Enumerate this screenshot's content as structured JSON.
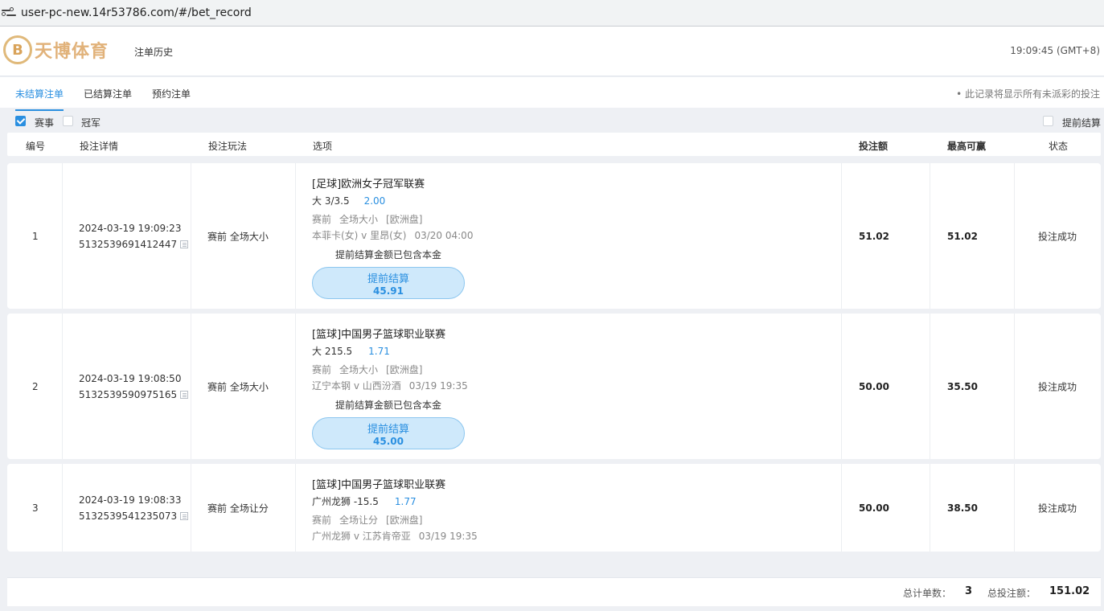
{
  "browser": {
    "url": "user-pc-new.14r53786.com/#/bet_record"
  },
  "header": {
    "logo_letter": "B",
    "brand": "天博体育",
    "page_title": "注单历史",
    "clock": "19:09:45 (GMT+8)"
  },
  "tabs": [
    {
      "label": "未结算注单",
      "active": true
    },
    {
      "label": "已结算注单",
      "active": false
    },
    {
      "label": "预约注单",
      "active": false
    }
  ],
  "notice": "• 此记录将显示所有未派彩的投注",
  "filters": {
    "event": {
      "label": "赛事",
      "checked": true
    },
    "champion": {
      "label": "冠军",
      "checked": false
    },
    "early_settle": {
      "label": "提前结算",
      "checked": false
    }
  },
  "columns": {
    "index": "编号",
    "detail": "投注详情",
    "play": "投注玩法",
    "option": "选项",
    "stake": "投注额",
    "max_win": "最高可赢",
    "status": "状态"
  },
  "rows": [
    {
      "index": "1",
      "datetime": "2024-03-19 19:09:23",
      "order_no": "5132539691412447",
      "play": "赛前 全场大小",
      "league": "[足球]欧洲女子冠军联赛",
      "pick": "大 3/3.5",
      "odds": "2.00",
      "meta": [
        "赛前",
        "全场大小",
        "[欧洲盘]"
      ],
      "match": "本菲卡(女) v 里昂(女)",
      "match_time": "03/20 04:00",
      "include_note": "提前结算金额已包含本金",
      "cashout_label": "提前结算",
      "cashout_amount": "45.91",
      "stake": "51.02",
      "max_win": "51.02",
      "status": "投注成功"
    },
    {
      "index": "2",
      "datetime": "2024-03-19 19:08:50",
      "order_no": "5132539590975165",
      "play": "赛前 全场大小",
      "league": "[篮球]中国男子篮球职业联赛",
      "pick": "大 215.5",
      "odds": "1.71",
      "meta": [
        "赛前",
        "全场大小",
        "[欧洲盘]"
      ],
      "match": "辽宁本钢 v 山西汾酒",
      "match_time": "03/19 19:35",
      "include_note": "提前结算金额已包含本金",
      "cashout_label": "提前结算",
      "cashout_amount": "45.00",
      "stake": "50.00",
      "max_win": "35.50",
      "status": "投注成功"
    },
    {
      "index": "3",
      "datetime": "2024-03-19 19:08:33",
      "order_no": "5132539541235073",
      "play": "赛前 全场让分",
      "league": "[篮球]中国男子篮球职业联赛",
      "pick": "广州龙狮 -15.5",
      "odds": "1.77",
      "meta": [
        "赛前",
        "全场让分",
        "[欧洲盘]"
      ],
      "match": "广州龙狮 v 江苏肯帝亚",
      "match_time": "03/19 19:35",
      "stake": "50.00",
      "max_win": "38.50",
      "status": "投注成功"
    }
  ],
  "footer": {
    "count_label": "总计单数：",
    "count": "3",
    "total_label": "总投注额：",
    "total": "151.02"
  }
}
